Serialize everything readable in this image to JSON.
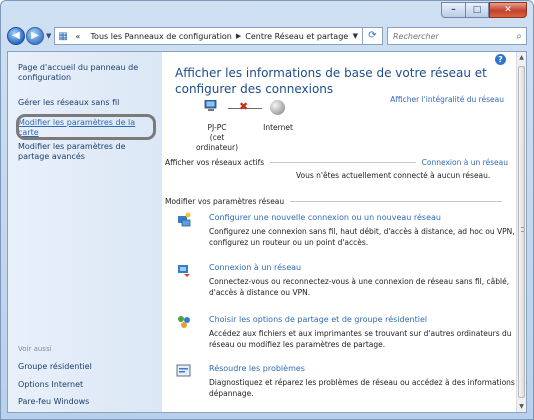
{
  "window": {
    "minimize": "–",
    "maximize": "□",
    "close": "✕"
  },
  "address_bar": {
    "back": "◀",
    "forward": "▶",
    "path": [
      "Tous les Panneaux de configuration",
      "Centre Réseau et partage"
    ],
    "prefix": "«",
    "search_placeholder": "Rechercher"
  },
  "sidebar": {
    "items": [
      {
        "label": "Page d'accueil du panneau de configuration"
      },
      {
        "label": "Gérer les réseaux sans fil"
      },
      {
        "label": "Modifier les paramètres de la carte"
      },
      {
        "label": "Modifier les paramètres de partage avancés"
      }
    ],
    "see_also": "Voir aussi",
    "see_also_items": [
      {
        "label": "Groupe résidentiel"
      },
      {
        "label": "Options Internet"
      },
      {
        "label": "Pare-feu Windows"
      }
    ]
  },
  "main": {
    "title": "Afficher les informations de base de votre réseau et configurer des connexions",
    "full_map_link": "Afficher l'intégralité du réseau",
    "network_map": {
      "computer_name": "PJ-PC",
      "computer_sub": "(cet ordinateur)",
      "internet": "Internet"
    },
    "active_networks": {
      "heading": "Afficher vos réseaux actifs",
      "connect_link": "Connexion à un réseau",
      "status": "Vous n'êtes actuellement connecté à aucun réseau."
    },
    "settings_heading": "Modifier vos paramètres réseau",
    "tasks": [
      {
        "title": "Configurer une nouvelle connexion ou un nouveau réseau",
        "desc": "Configurez une connexion sans fil, haut débit, d'accès à distance, ad hoc ou VPN, ou configurez un routeur ou un point d'accès."
      },
      {
        "title": "Connexion à un réseau",
        "desc": "Connectez-vous ou reconnectez-vous à une connexion de réseau sans fil, câblé, d'accès à distance ou VPN."
      },
      {
        "title": "Choisir les options de partage et de groupe résidentiel",
        "desc": "Accédez aux fichiers et aux imprimantes se trouvant sur d'autres ordinateurs du réseau ou modifiez les paramètres de partage."
      },
      {
        "title": "Résoudre les problèmes",
        "desc": "Diagnostiquez et réparez les problèmes de réseau ou accédez à des informations de dépannage."
      }
    ]
  }
}
